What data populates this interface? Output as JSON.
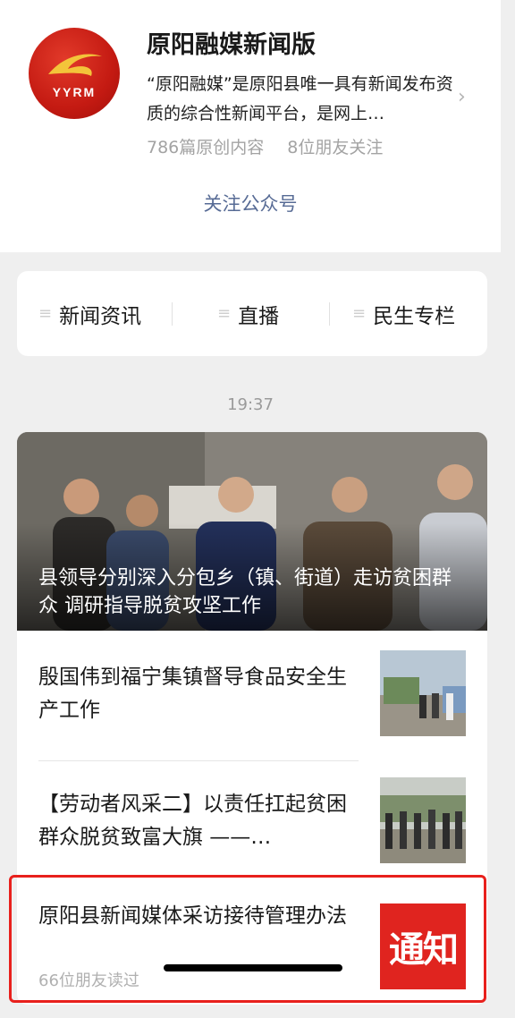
{
  "account": {
    "name": "原阳融媒新闻版",
    "logo_text": "YYRM",
    "description": "“原阳融媒”是原阳县唯一具有新闻发布资质的综合性新闻平台，是网上…",
    "original_count": "786篇原创内容",
    "friends_follow": "8位朋友关注",
    "follow_label": "关注公众号"
  },
  "menu": {
    "items": [
      {
        "label": "新闻资讯",
        "icon": "list-icon"
      },
      {
        "label": "直播",
        "icon": "list-icon"
      },
      {
        "label": "民生专栏",
        "icon": "list-icon"
      }
    ]
  },
  "feed": {
    "time": "19:37",
    "hero_title": "县领导分别深入分包乡（镇、街道）走访贫困群众 调研指导脱贫攻坚工作",
    "articles": [
      {
        "title": "殷国伟到福宁集镇督导食品安全生产工作"
      },
      {
        "title": "【劳动者风采二】以责任扛起贫困群众脱贫致富大旗 ——…"
      },
      {
        "title": "原阳县新闻媒体采访接待管理办法",
        "readers": "66位朋友读过",
        "thumb_text": "通知"
      }
    ]
  },
  "colors": {
    "link_blue": "#576b95",
    "highlight_red": "#e8201c",
    "brand_red": "#c41a12"
  }
}
